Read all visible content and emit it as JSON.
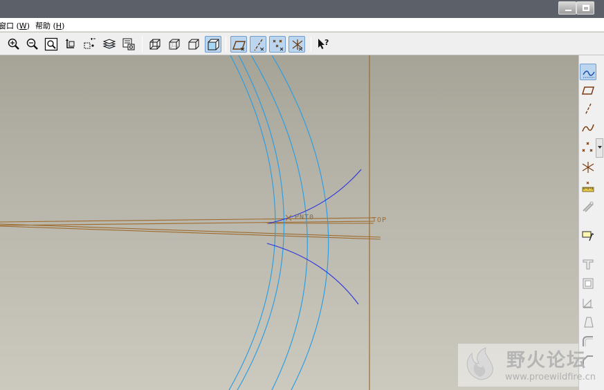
{
  "window": {
    "controls": [
      "minimize-icon",
      "restore-icon"
    ]
  },
  "menubar": {
    "items": [
      {
        "label": "窗口",
        "mnemonic": "W"
      },
      {
        "label": "帮助",
        "mnemonic": "H"
      }
    ]
  },
  "toolbar": {
    "buttons": [
      "zoom-in-icon",
      "zoom-out-icon",
      "refit-icon",
      "reorient-icon",
      "spin-center-icon",
      "layers-icon",
      "view-manager-icon",
      "wireframe-icon",
      "hidden-line-icon",
      "no-hidden-icon",
      "shading-icon",
      "datum-planes-display-icon",
      "datum-axes-display-icon",
      "point-display-icon",
      "csys-display-icon",
      "whats-this-icon"
    ],
    "active": [
      "shading-icon",
      "datum-planes-display-icon",
      "datum-axes-display-icon",
      "point-display-icon",
      "csys-display-icon"
    ]
  },
  "viewport": {
    "datum_labels": {
      "point": "PNT0",
      "plane": "TOP"
    },
    "colors": {
      "curves": "#2f9ee0",
      "sketch": "#2630e0",
      "datum": "#9d6a2c"
    }
  },
  "right_toolbar": {
    "buttons": [
      "sketch-datum-curve-icon",
      "datum-plane-icon",
      "datum-axis-icon",
      "datum-curve-icon",
      "datum-point-icon",
      "datum-csys-icon",
      "analysis-feature-icon",
      "insert-reference-icon",
      "sketch-icon",
      "extrude-icon",
      "shell-icon",
      "rib-icon",
      "draft-icon",
      "round-icon",
      "chamfer-icon"
    ]
  },
  "watermark": {
    "title": "野火论坛",
    "url": "www.proewildfire.cn"
  }
}
